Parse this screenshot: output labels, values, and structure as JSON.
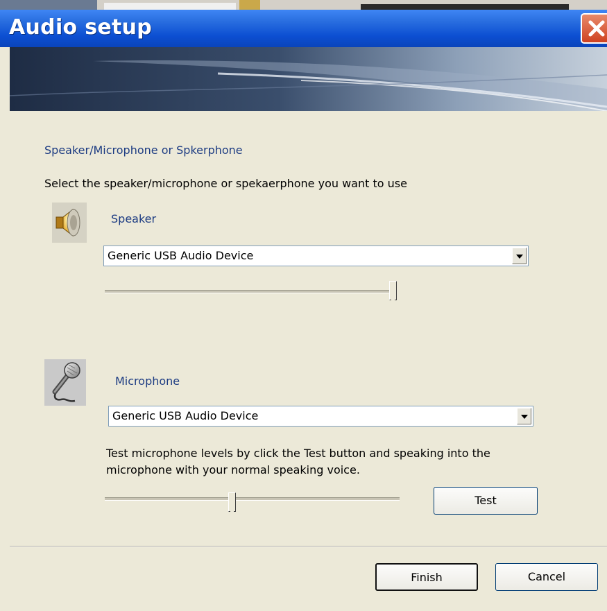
{
  "window": {
    "title": "Audio setup"
  },
  "section_title": "Speaker/Microphone or Spkerphone",
  "instruction": "Select the speaker/microphone or spekaerphone you want to use",
  "speaker": {
    "label": "Speaker",
    "device": "Generic USB Audio Device",
    "volume_level": 0.97,
    "icon": "speaker-icon"
  },
  "microphone": {
    "label": "Microphone",
    "device": "Generic USB Audio Device",
    "help_text": "Test microphone levels by click the Test button and speaking into the microphone with your normal speaking voice.",
    "level": 0.42,
    "icon": "microphone-icon"
  },
  "buttons": {
    "test": "Test",
    "finish": "Finish",
    "cancel": "Cancel"
  },
  "colors": {
    "titlebar": "#0c4fd2",
    "label_blue": "#1c3b82",
    "dialog_bg": "#ece9d8",
    "close_red": "#d0482a"
  }
}
